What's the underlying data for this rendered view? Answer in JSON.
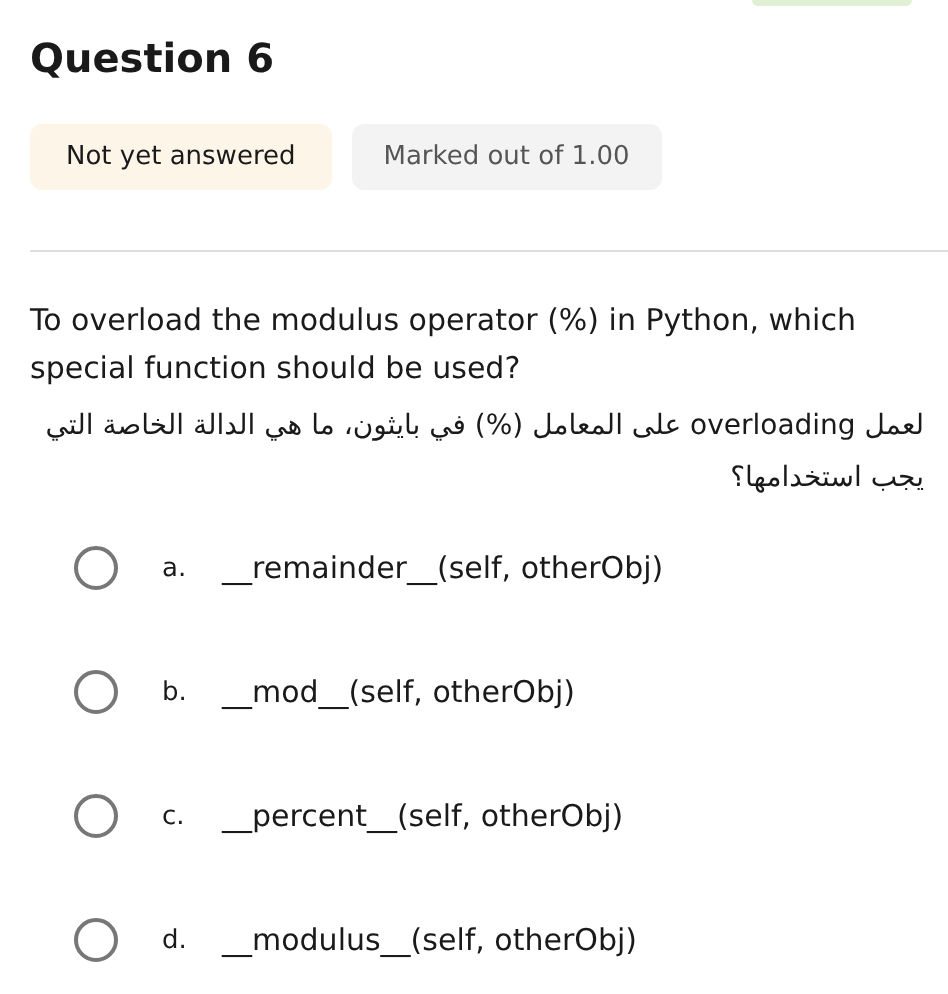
{
  "title": "Question 6",
  "status_badges": [
    {
      "text": "Not yet answered",
      "kind": "status"
    },
    {
      "text": "Marked out of 1.00",
      "kind": "grade"
    }
  ],
  "question": {
    "text": "To overload the modulus operator (%) in Python, which special function should be used?",
    "translation": "لعمل overloading على المعامل (%) في بايثون، ما هي الدالة الخاصة التي يجب استخدامها؟"
  },
  "options": [
    {
      "letter": "a.",
      "text": "__remainder__(self, otherObj)",
      "selected": false
    },
    {
      "letter": "b.",
      "text": "__mod__(self, otherObj)",
      "selected": false
    },
    {
      "letter": "c.",
      "text": "__percent__(self, otherObj)",
      "selected": false
    },
    {
      "letter": "d.",
      "text": "__modulus__(self, otherObj)",
      "selected": false
    }
  ]
}
